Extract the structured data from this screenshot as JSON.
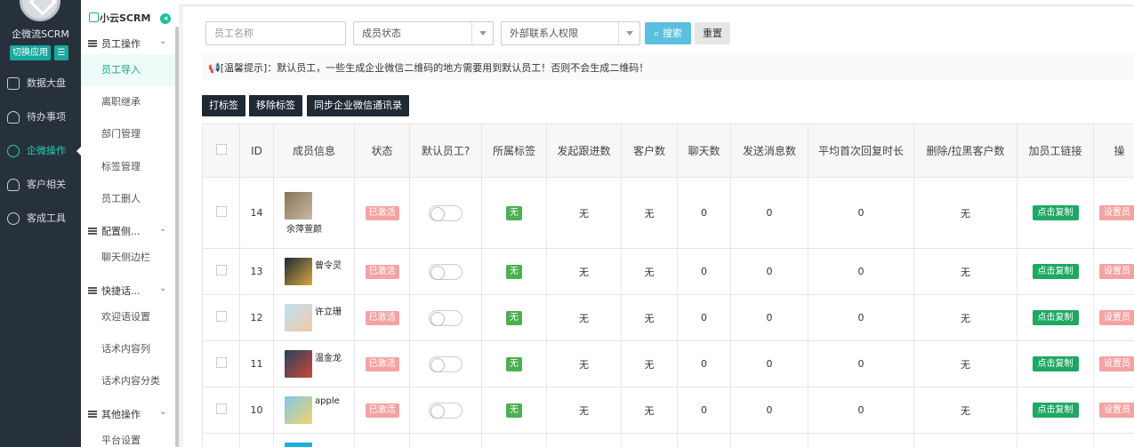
{
  "nav": {
    "app_name": "企微流SCRM",
    "switch_label": "切换应用",
    "switch_icon": "switch-icon",
    "items": [
      {
        "label": "数据大盘",
        "icon": "dashboard-icon"
      },
      {
        "label": "待办事项",
        "icon": "todo-user-icon"
      },
      {
        "label": "企微操作",
        "icon": "wecom-icon",
        "active": true
      },
      {
        "label": "客户相关",
        "icon": "customer-icon"
      },
      {
        "label": "客成工具",
        "icon": "tools-icon"
      }
    ]
  },
  "sub": {
    "brand": "小云SCRM",
    "groups": [
      {
        "label": "员工操作",
        "items": [
          "员工导入",
          "离职继承",
          "部门管理",
          "标签管理",
          "员工删人"
        ]
      },
      {
        "label": "配置侧...",
        "items": [
          "聊天侧边栏"
        ]
      },
      {
        "label": "快捷话...",
        "items": [
          "欢迎语设置",
          "话术内容列",
          "话术内容分类"
        ]
      },
      {
        "label": "其他操作",
        "items": [
          "平台设置"
        ]
      }
    ]
  },
  "filters": {
    "name_placeholder": "员工名称",
    "status_label": "成员状态",
    "external_label": "外部联系人权限",
    "search_label": "搜索",
    "reset_label": "重置"
  },
  "tip": "[温馨提示]：默认员工，一些生成企业微信二维码的地方需要用到默认员工！否则不会生成二维码！",
  "actions": {
    "tag": "打标签",
    "untag": "移除标签",
    "sync": "同步企业微信通讯录"
  },
  "table": {
    "headers": [
      "ID",
      "成员信息",
      "状态",
      "默认员工?",
      "所属标签",
      "发起跟进数",
      "客户数",
      "聊天数",
      "发送消息数",
      "平均首次回复时长",
      "删除/拉黑客户数",
      "加员工链接",
      "操"
    ],
    "rows": [
      {
        "id": "14",
        "name": "余萍萱颜",
        "status": "已激活",
        "tag": "无",
        "follow": "无",
        "customers": "无",
        "chats": "0",
        "messages": "0",
        "reply": "0",
        "deleted": "无",
        "link": "点击复制",
        "op": "设置员",
        "avatar": [
          "#8b7355",
          "#c7b9a5"
        ]
      },
      {
        "id": "13",
        "name": "曾令灵",
        "status": "已激活",
        "tag": "无",
        "follow": "无",
        "customers": "无",
        "chats": "0",
        "messages": "0",
        "reply": "0",
        "deleted": "无",
        "link": "点击复制",
        "op": "设置员",
        "avatar": [
          "#1b2a3a",
          "#d8a93c"
        ]
      },
      {
        "id": "12",
        "name": "许立珊",
        "status": "已激活",
        "tag": "无",
        "follow": "无",
        "customers": "无",
        "chats": "0",
        "messages": "0",
        "reply": "0",
        "deleted": "无",
        "link": "点击复制",
        "op": "设置员",
        "avatar": [
          "#bfe3f2",
          "#f0c8a8"
        ]
      },
      {
        "id": "11",
        "name": "温金龙",
        "status": "已激活",
        "tag": "无",
        "follow": "无",
        "customers": "无",
        "chats": "0",
        "messages": "0",
        "reply": "0",
        "deleted": "无",
        "link": "点击复制",
        "op": "设置员",
        "avatar": [
          "#2b3f5c",
          "#c74a3a"
        ]
      },
      {
        "id": "10",
        "name": "apple",
        "status": "已激活",
        "tag": "无",
        "follow": "无",
        "customers": "无",
        "chats": "0",
        "messages": "0",
        "reply": "0",
        "deleted": "无",
        "link": "点击复制",
        "op": "设置员",
        "avatar": [
          "#7ec8e8",
          "#f4d36b"
        ]
      }
    ]
  }
}
